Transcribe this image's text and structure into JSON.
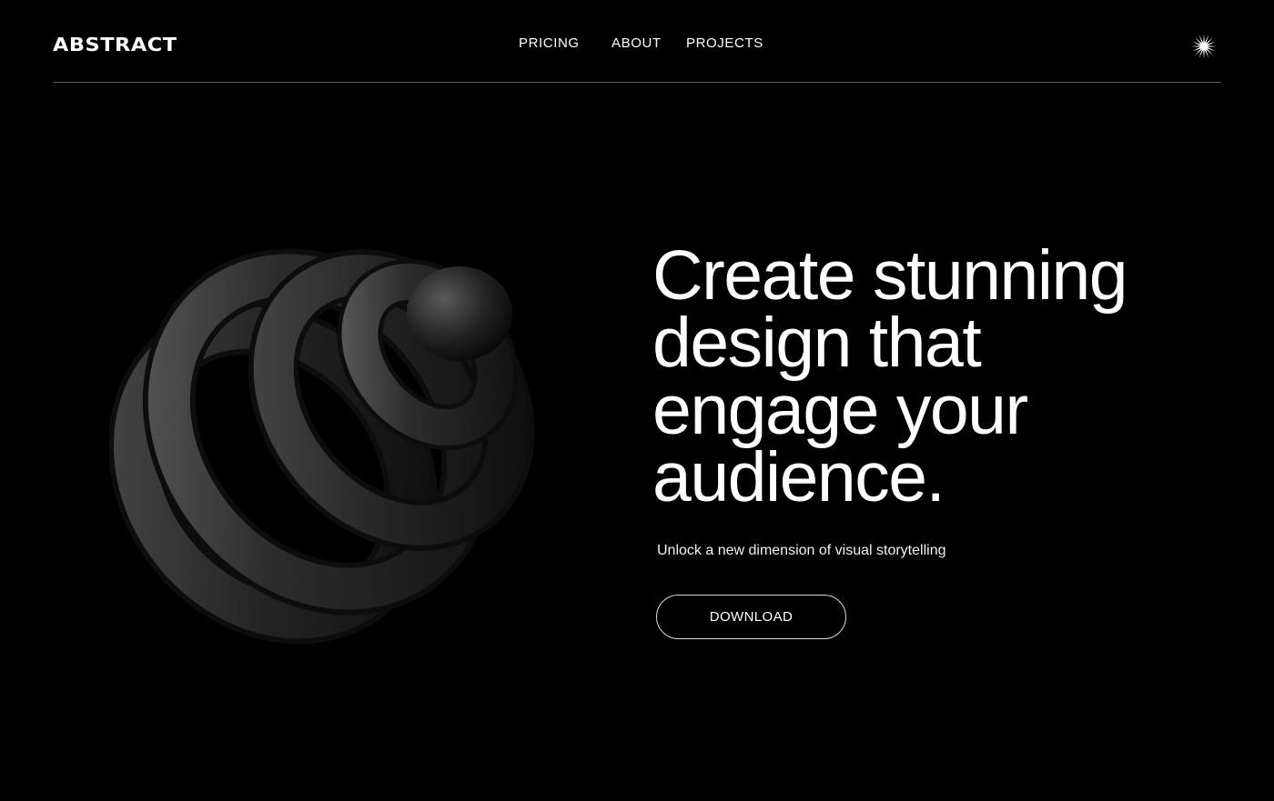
{
  "brand": {
    "logo": "ABSTRACT"
  },
  "nav": {
    "items": [
      "PRICING",
      "ABOUT",
      "PROJECTS"
    ],
    "menu_icon": "starburst-icon"
  },
  "hero": {
    "headline_lines": [
      "Create stunning",
      "design that",
      "engage your",
      "audience."
    ],
    "subtitle": "Unlock a new dimension of visual storytelling",
    "cta_label": "DOWNLOAD",
    "image": "black-3d-spiral-coil-illustration"
  },
  "colors": {
    "background": "#000000",
    "text": "#ffffff",
    "divider": "#5a5a5a",
    "button_border": "#d8d8d8"
  }
}
